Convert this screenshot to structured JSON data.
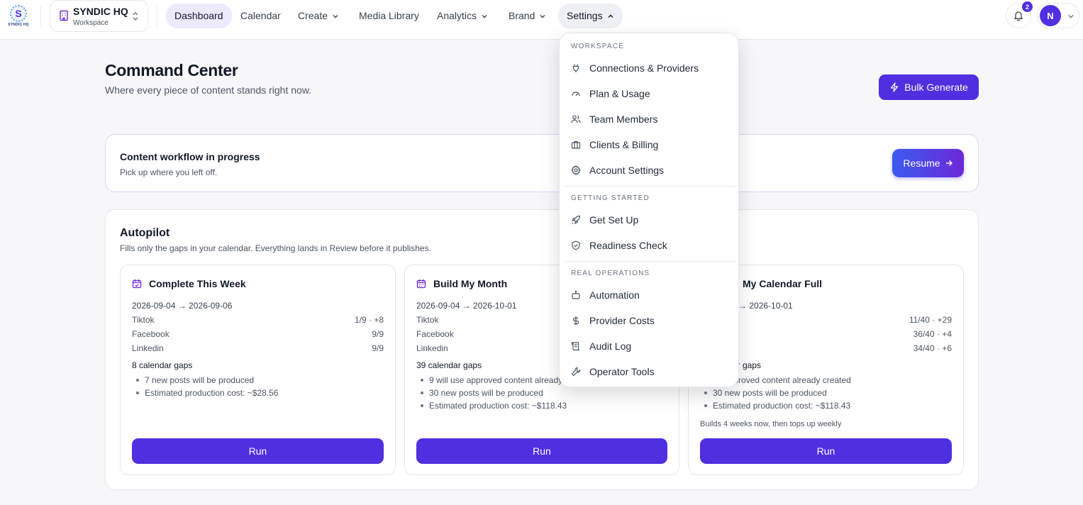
{
  "brand": {
    "logo_letter": "S",
    "logo_text": "SYNDIC HQ"
  },
  "workspace": {
    "name": "SYNDIC HQ",
    "subtitle": "Workspace"
  },
  "nav": {
    "dashboard": "Dashboard",
    "calendar": "Calendar",
    "create": "Create",
    "media_library": "Media Library",
    "analytics": "Analytics",
    "brand": "Brand",
    "settings": "Settings"
  },
  "notifications": {
    "count": "2"
  },
  "user": {
    "initial": "N"
  },
  "header": {
    "title": "Command Center",
    "subtitle": "Where every piece of content stands right now.",
    "bulk_generate": "Bulk Generate"
  },
  "workflow": {
    "title": "Content workflow in progress",
    "subtitle": "Pick up where you left off.",
    "resume": "Resume"
  },
  "autopilot": {
    "title": "Autopilot",
    "subtitle": "Fills only the gaps in your calendar. Everything lands in Review before it publishes.",
    "plans": [
      {
        "title": "Complete This Week",
        "range": "2026-09-04 → 2026-09-06",
        "rows": [
          {
            "platform": "Tiktok",
            "value": "1/9 · +8"
          },
          {
            "platform": "Facebook",
            "value": "9/9"
          },
          {
            "platform": "Linkedin",
            "value": "9/9"
          }
        ],
        "gaps": "8 calendar gaps",
        "bullets": [
          "7 new posts will be produced",
          "Estimated production cost: ~$28.56"
        ],
        "note": "",
        "run": "Run"
      },
      {
        "title": "Build My Month",
        "range": "2026-09-04 → 2026-10-01",
        "rows": [
          {
            "platform": "Tiktok",
            "value": ""
          },
          {
            "platform": "Facebook",
            "value": ""
          },
          {
            "platform": "Linkedin",
            "value": ""
          }
        ],
        "gaps": "39 calendar gaps",
        "bullets": [
          "9 will use approved content already",
          "30 new posts will be produced",
          "Estimated production cost: ~$118.43"
        ],
        "note": "",
        "run": "Run"
      },
      {
        "title": "My Calendar Full",
        "range": "4 → 2026-10-01",
        "rows": [
          {
            "platform": "",
            "value": "11/40 · +29"
          },
          {
            "platform": "",
            "value": "36/40 · +4"
          },
          {
            "platform": "",
            "value": "34/40 · +6"
          }
        ],
        "gaps": "ar gaps",
        "bullets": [
          "se approved content already created",
          "30 new posts will be produced",
          "Estimated production cost: ~$118.43"
        ],
        "note": "Builds 4 weeks now, then tops up weekly",
        "run": "Run"
      }
    ]
  },
  "settings_menu": {
    "workspace_heading": "WORKSPACE",
    "connections": "Connections & Providers",
    "plan_usage": "Plan & Usage",
    "team_members": "Team Members",
    "clients_billing": "Clients & Billing",
    "account_settings": "Account Settings",
    "getting_started_heading": "GETTING STARTED",
    "get_set_up": "Get Set Up",
    "readiness_check": "Readiness Check",
    "real_operations_heading": "REAL OPERATIONS",
    "automation": "Automation",
    "provider_costs": "Provider Costs",
    "audit_log": "Audit Log",
    "operator_tools": "Operator Tools"
  },
  "colors": {
    "accent": "#4f2fe0",
    "active_tab": "#ede9fe",
    "text": "#111827",
    "muted": "#4b5563"
  }
}
